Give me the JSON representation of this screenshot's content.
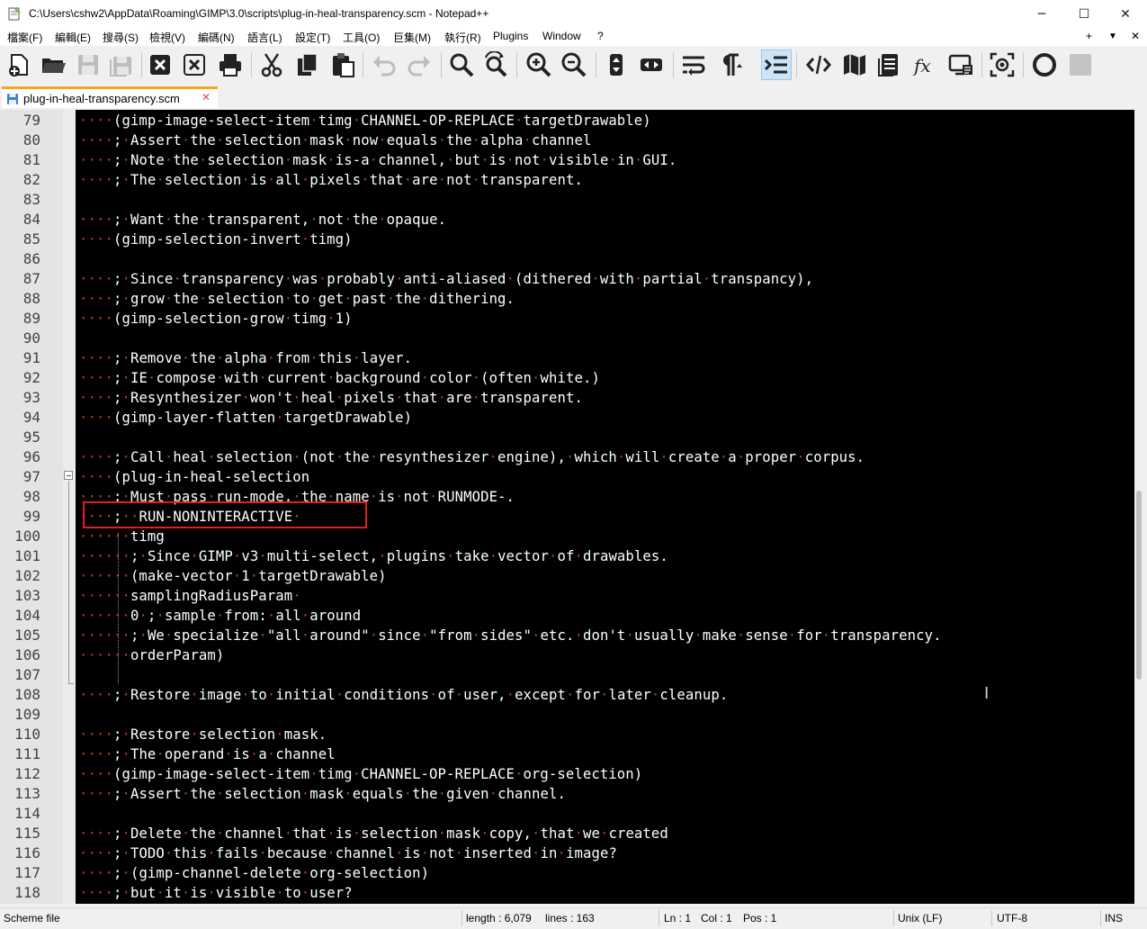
{
  "window": {
    "title": "C:\\Users\\cshw2\\AppData\\Roaming\\GIMP\\3.0\\scripts\\plug-in-heal-transparency.scm - Notepad++",
    "minimize": "─",
    "maximize": "☐",
    "close": "✕"
  },
  "menu": {
    "items": [
      "檔案(F)",
      "編輯(E)",
      "搜尋(S)",
      "檢視(V)",
      "編碼(N)",
      "語言(L)",
      "設定(T)",
      "工具(O)",
      "巨集(M)",
      "執行(R)",
      "Plugins",
      "Window",
      "?"
    ],
    "plus": "+",
    "dropdown": "▼",
    "close": "✕"
  },
  "toolbar": {
    "icons": [
      "new-file-icon",
      "open-file-icon",
      "save-icon",
      "save-all-icon",
      "close-icon",
      "close-all-icon",
      "print-icon",
      "cut-icon",
      "copy-icon",
      "paste-icon",
      "undo-icon",
      "redo-icon",
      "find-icon",
      "replace-icon",
      "zoom-in-icon",
      "zoom-out-icon",
      "sync-vertical-icon",
      "sync-horizontal-icon",
      "word-wrap-icon",
      "show-all-characters-icon",
      "indent-guide-icon",
      "xml-tag-icon",
      "document-map-icon",
      "document-list-icon",
      "function-list-icon",
      "folder-workspace-icon",
      "monitoring-icon",
      "record-macro-icon",
      "stop-record-icon"
    ]
  },
  "tab": {
    "label": "plug-in-heal-transparency.scm",
    "close": "✕"
  },
  "editor": {
    "lines": [
      {
        "n": "79",
        "ws": "····",
        "code": "(gimp-image-select-item·timg·CHANNEL-OP-REPLACE·targetDrawable)"
      },
      {
        "n": "80",
        "ws": "····",
        "code": ";·Assert·the·selection·mask·now·equals·the·alpha·channel"
      },
      {
        "n": "81",
        "ws": "····",
        "code": ";·Note·the·selection·mask·is-a·channel,·but·is·not·visible·in·GUI."
      },
      {
        "n": "82",
        "ws": "····",
        "code": ";·The·selection·is·all·pixels·that·are·not·transparent."
      },
      {
        "n": "83",
        "ws": "",
        "code": ""
      },
      {
        "n": "84",
        "ws": "····",
        "code": ";·Want·the·transparent,·not·the·opaque."
      },
      {
        "n": "85",
        "ws": "····",
        "code": "(gimp-selection-invert·timg)"
      },
      {
        "n": "86",
        "ws": "",
        "code": ""
      },
      {
        "n": "87",
        "ws": "····",
        "code": ";·Since·transparency·was·probably·anti-aliased·(dithered·with·partial·transpancy),"
      },
      {
        "n": "88",
        "ws": "····",
        "code": ";·grow·the·selection·to·get·past·the·dithering."
      },
      {
        "n": "89",
        "ws": "····",
        "code": "(gimp-selection-grow·timg·1)"
      },
      {
        "n": "90",
        "ws": "",
        "code": ""
      },
      {
        "n": "91",
        "ws": "····",
        "code": ";·Remove·the·alpha·from·this·layer."
      },
      {
        "n": "92",
        "ws": "····",
        "code": ";·IE·compose·with·current·background·color·(often·white.)"
      },
      {
        "n": "93",
        "ws": "····",
        "code": ";·Resynthesizer·won't·heal·pixels·that·are·transparent."
      },
      {
        "n": "94",
        "ws": "····",
        "code": "(gimp-layer-flatten·targetDrawable)"
      },
      {
        "n": "95",
        "ws": "",
        "code": ""
      },
      {
        "n": "96",
        "ws": "····",
        "code": ";·Call·heal·selection·(not·the·resynthesizer·engine),·which·will·create·a·proper·corpus."
      },
      {
        "n": "97",
        "ws": "····",
        "code": "(plug-in-heal-selection"
      },
      {
        "n": "98",
        "ws": "····",
        "code": ";·Must·pass·run-mode,·the·name·is·not·RUNMODE-."
      },
      {
        "n": "99",
        "ws": "····",
        "code": ";··RUN-NONINTERACTIVE·"
      },
      {
        "n": "100",
        "ws": "······",
        "code": "timg"
      },
      {
        "n": "101",
        "ws": "······",
        "code": ";·Since·GIMP·v3·multi-select,·plugins·take·vector·of·drawables."
      },
      {
        "n": "102",
        "ws": "······",
        "code": "(make-vector·1·targetDrawable)"
      },
      {
        "n": "103",
        "ws": "······",
        "code": "samplingRadiusParam·"
      },
      {
        "n": "104",
        "ws": "······",
        "code": "0·;·sample·from:·all·around"
      },
      {
        "n": "105",
        "ws": "······",
        "code": ";·We·specialize·\"all·around\"·since·\"from·sides\"·etc.·don't·usually·make·sense·for·transparency."
      },
      {
        "n": "106",
        "ws": "······",
        "code": "orderParam)"
      },
      {
        "n": "107",
        "ws": "",
        "code": ""
      },
      {
        "n": "108",
        "ws": "····",
        "code": ";·Restore·image·to·initial·conditions·of·user,·except·for·later·cleanup."
      },
      {
        "n": "109",
        "ws": "",
        "code": ""
      },
      {
        "n": "110",
        "ws": "····",
        "code": ";·Restore·selection·mask."
      },
      {
        "n": "111",
        "ws": "····",
        "code": ";·The·operand·is·a·channel"
      },
      {
        "n": "112",
        "ws": "····",
        "code": "(gimp-image-select-item·timg·CHANNEL-OP-REPLACE·org-selection)"
      },
      {
        "n": "113",
        "ws": "····",
        "code": ";·Assert·the·selection·mask·equals·the·given·channel."
      },
      {
        "n": "114",
        "ws": "",
        "code": ""
      },
      {
        "n": "115",
        "ws": "····",
        "code": ";·Delete·the·channel·that·is·selection·mask·copy,·that·we·created"
      },
      {
        "n": "116",
        "ws": "····",
        "code": ";·TODO·this·fails·because·channel·is·not·inserted·in·image?"
      },
      {
        "n": "117",
        "ws": "····",
        "code": ";·(gimp-channel-delete·org-selection)"
      },
      {
        "n": "118",
        "ws": "····",
        "code": ";·but·it·is·visible·to·user?"
      }
    ]
  },
  "status": {
    "file_type": "Scheme file",
    "length": "length : 6,079",
    "lines": "lines : 163",
    "ln": "Ln : 1",
    "col": "Col : 1",
    "pos": "Pos : 1",
    "eol": "Unix (LF)",
    "encoding": "UTF-8",
    "mode": "INS"
  },
  "colors": {
    "editor_bg": "#000000",
    "text": "#ffffff",
    "whitespace": "#c0392b",
    "highlight_box": "#e0201e",
    "tab_accent": "#f5a623"
  }
}
